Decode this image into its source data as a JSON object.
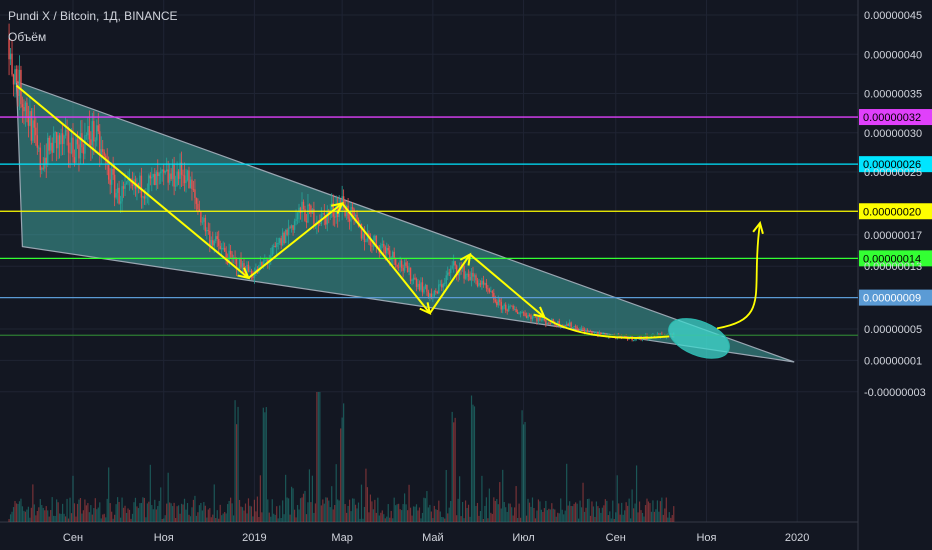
{
  "header": {
    "title": "Pundi X / Bitcoin, 1Д, BINANCE",
    "volume_label": "Объём"
  },
  "colors": {
    "background": "#131722",
    "grid": "#1f2433",
    "candle_up": "#26a69a",
    "candle_down": "#ef5350",
    "wedge_fill": "#4fd1c5",
    "arrow": "#ffff00",
    "axis_text": "#d1d4dc"
  },
  "chart_data": {
    "type": "candlestick",
    "symbol": "Pundi X / Bitcoin",
    "interval": "1Д",
    "exchange": "BINANCE",
    "y_axis": {
      "ticks": [
        "0.00000045",
        "0.00000040",
        "0.00000035",
        "0.00000030",
        "0.00000025",
        "0.00000017",
        "0.00000013",
        "0.00000005",
        "0.00000001",
        "-0.00000003"
      ],
      "tick_values": [
        45,
        40,
        35,
        30,
        25,
        17,
        13,
        5,
        1,
        -3
      ]
    },
    "x_axis": {
      "ticks": [
        "Сен",
        "Ноя",
        "2019",
        "Мар",
        "Май",
        "Июл",
        "Сен",
        "Ноя",
        "2020"
      ],
      "tick_dates": [
        "2018-09-01",
        "2018-11-01",
        "2019-01-01",
        "2019-03-01",
        "2019-05-01",
        "2019-07-01",
        "2019-09-01",
        "2019-11-01",
        "2020-01-01"
      ]
    },
    "horizontal_levels": [
      {
        "label": "0.00000032",
        "value": 32,
        "color": "#e040fb",
        "text_color": "#000000"
      },
      {
        "label": "0.00000026",
        "value": 26,
        "color": "#00e5ff",
        "text_color": "#000000"
      },
      {
        "label": "0.00000020",
        "value": 20,
        "color": "#ffff00",
        "text_color": "#000000"
      },
      {
        "label": "0.00000014",
        "value": 14,
        "color": "#33ff33",
        "text_color": "#000000"
      },
      {
        "label": "0.00000009",
        "value": 9,
        "color": "#5b9bd5",
        "text_color": "#ffffff"
      },
      {
        "label": "",
        "value": 4.2,
        "color": "#2e7d32",
        "text_color": "#ffffff"
      }
    ],
    "price_path": [
      [
        "2018-07-20",
        40
      ],
      [
        "2018-07-25",
        37
      ],
      [
        "2018-08-01",
        33
      ],
      [
        "2018-08-10",
        26
      ],
      [
        "2018-08-20",
        29
      ],
      [
        "2018-09-01",
        28
      ],
      [
        "2018-09-15",
        30
      ],
      [
        "2018-10-01",
        22
      ],
      [
        "2018-10-15",
        23
      ],
      [
        "2018-11-01",
        24
      ],
      [
        "2018-11-15",
        25
      ],
      [
        "2018-12-01",
        17
      ],
      [
        "2018-12-15",
        14
      ],
      [
        "2019-01-01",
        12
      ],
      [
        "2019-01-15",
        15
      ],
      [
        "2019-02-01",
        20
      ],
      [
        "2019-02-15",
        19
      ],
      [
        "2019-03-01",
        21
      ],
      [
        "2019-03-15",
        17
      ],
      [
        "2019-04-01",
        15
      ],
      [
        "2019-04-15",
        12
      ],
      [
        "2019-05-01",
        9
      ],
      [
        "2019-05-15",
        13
      ],
      [
        "2019-06-01",
        11
      ],
      [
        "2019-06-15",
        8
      ],
      [
        "2019-07-01",
        7
      ],
      [
        "2019-07-15",
        6
      ],
      [
        "2019-08-01",
        5.5
      ],
      [
        "2019-08-15",
        4.5
      ],
      [
        "2019-09-01",
        4
      ],
      [
        "2019-09-15",
        3.8
      ],
      [
        "2019-10-01",
        4.2
      ],
      [
        "2019-10-10",
        4.2
      ]
    ],
    "volume": {
      "spike_dates": [
        "2018-12-20",
        "2019-01-08",
        "2019-02-13",
        "2019-03-01",
        "2019-05-15",
        "2019-05-28",
        "2019-07-01"
      ],
      "max_spike_date": "2019-02-13"
    },
    "annotations": {
      "wedge": {
        "points": [
          [
            "2018-07-25",
            36.5
          ],
          [
            "2018-07-29",
            15.5
          ],
          [
            "2019-12-30",
            0.8
          ]
        ]
      },
      "zigzag_arrows": [
        [
          [
            "2018-07-25",
            36
          ],
          [
            "2018-12-28",
            11.5
          ]
        ],
        [
          [
            "2018-12-28",
            11.5
          ],
          [
            "2019-03-01",
            21
          ]
        ],
        [
          [
            "2019-03-01",
            21
          ],
          [
            "2019-04-29",
            7
          ]
        ],
        [
          [
            "2019-04-29",
            7
          ],
          [
            "2019-05-26",
            14.5
          ]
        ],
        [
          [
            "2019-05-26",
            14.5
          ],
          [
            "2019-07-15",
            6.5
          ]
        ]
      ],
      "breakout_ellipse": {
        "center": [
          "2019-10-27",
          3.8
        ]
      },
      "breakout_arrow_target": [
        "2019-12-07",
        18.5
      ]
    }
  }
}
